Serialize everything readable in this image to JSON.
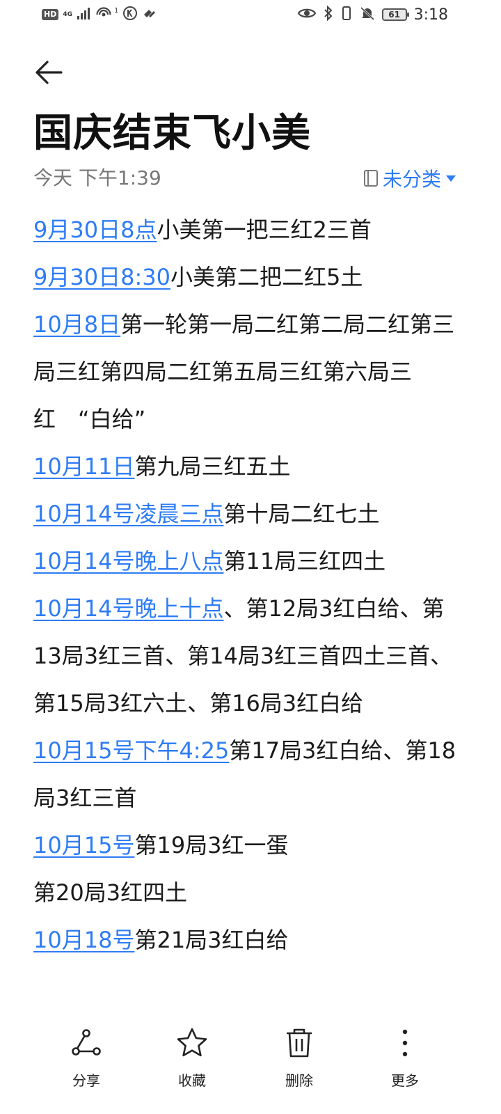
{
  "status_bar": {
    "hd": "HD",
    "network_type": "4G",
    "hotspot_count": "1",
    "battery": "61",
    "time": "3:18",
    "icons": [
      "signal-icon",
      "hotspot-icon",
      "k-app-icon",
      "link-icon",
      "eye-icon",
      "bluetooth-icon",
      "vibrate-icon",
      "mute-icon",
      "battery-icon"
    ]
  },
  "header": {
    "back_icon": "back-arrow-icon",
    "title": "国庆结束飞小美",
    "time": "今天 下午1:39",
    "category": "未分类",
    "category_icon": "notebook-icon"
  },
  "body": {
    "lines": [
      {
        "date": "9月30日8点",
        "text": "小美第一把三红2三首"
      },
      {
        "date": "9月30日8:30",
        "text": "小美第二把二红5土"
      },
      {
        "date": "10月8日",
        "text": "第一轮第一局二红第二局二红第三局三红第四局二红第五局三红第六局三红　“白给”"
      },
      {
        "date": "10月11日",
        "text": "第九局三红五土"
      },
      {
        "date": "10月14号凌晨三点",
        "text": "第十局二红七土"
      },
      {
        "date": "10月14号晚上八点",
        "text": "第11局三红四土"
      },
      {
        "date": "10月14号晚上十点",
        "text": "、第12局3红白给、第13局3红三首、第14局3红三首四土三首、第15局3红六土、第16局3红白给"
      },
      {
        "date": "10月15号下午4:25",
        "text": "第17局3红白给、第18局3红三首"
      },
      {
        "date": "10月15号",
        "text": "第19局3红一蛋"
      },
      {
        "date": "",
        "text": "第20局3红四土"
      },
      {
        "date": "10月18号",
        "text": "第21局3红白给"
      }
    ]
  },
  "bottom_bar": {
    "share_label": "分享",
    "favorite_label": "收藏",
    "delete_label": "删除",
    "more_label": "更多"
  },
  "colors": {
    "accent": "#2e7cf6",
    "text": "#1a1a1a",
    "muted": "#777777"
  }
}
